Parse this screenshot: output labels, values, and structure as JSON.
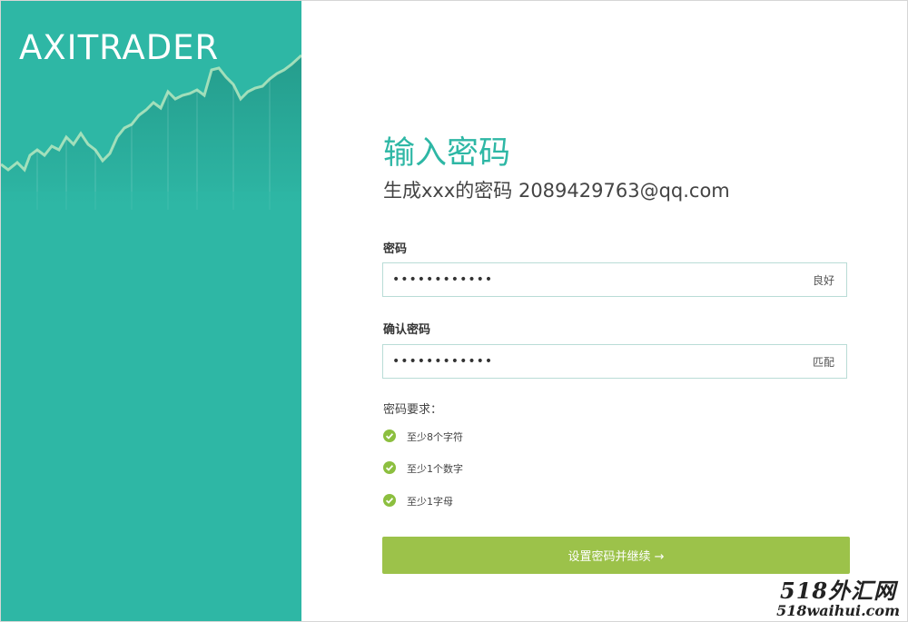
{
  "brand": {
    "logo_text": "AXITRADER"
  },
  "form": {
    "title": "输入密码",
    "subtitle": "生成xxx的密码 2089429763@qq.com",
    "password": {
      "label": "密码",
      "value": "••••••••••••",
      "strength": "良好"
    },
    "confirm": {
      "label": "确认密码",
      "value": "••••••••••••",
      "status": "匹配"
    },
    "requirements": {
      "title": "密码要求：",
      "items": [
        "至少8个字符",
        "至少1个数字",
        "至少1字母"
      ]
    },
    "submit_label": "设置密码并继续 →"
  },
  "watermark": {
    "top": "518外汇网",
    "bottom": "518waihui.com"
  },
  "colors": {
    "teal": "#2eb7a5",
    "green": "#9cc24a",
    "check": "#8cbf3f"
  }
}
